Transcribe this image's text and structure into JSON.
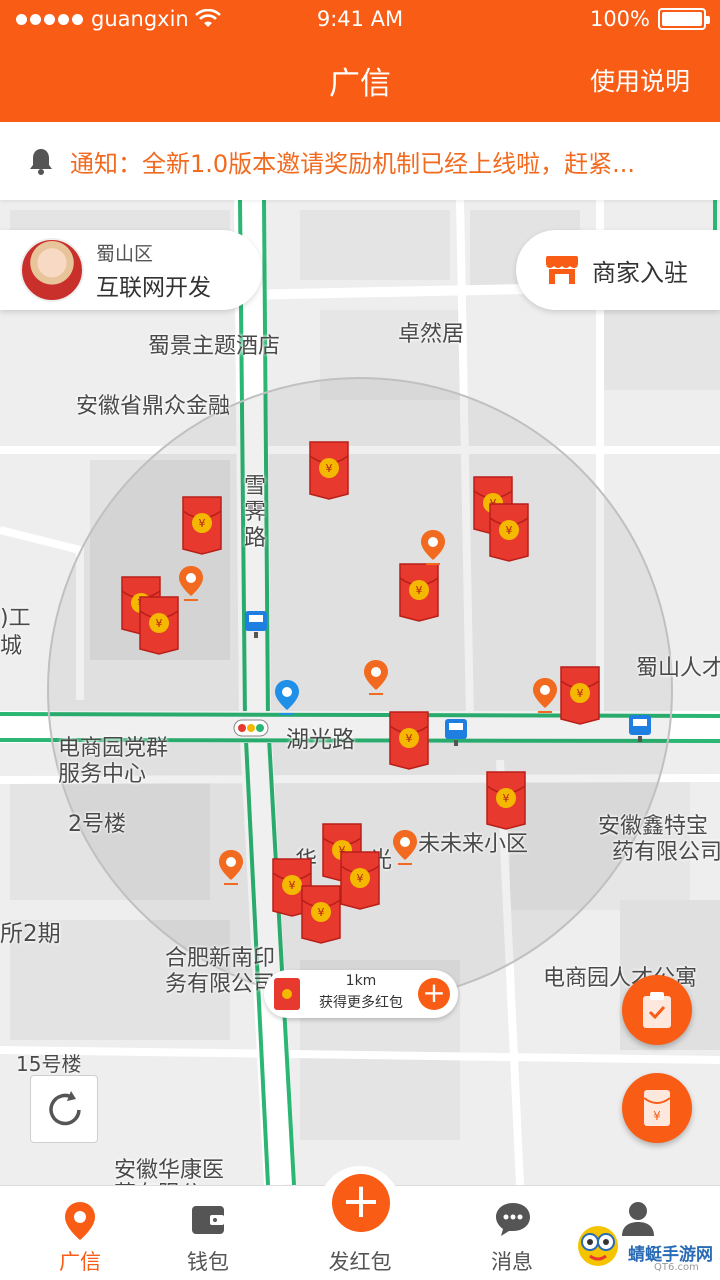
{
  "status_bar": {
    "carrier": "guangxin",
    "time": "9:41 AM",
    "battery": "100%"
  },
  "nav": {
    "title": "广信",
    "help": "使用说明"
  },
  "notice": {
    "text": "通知：全新1.0版本邀请奖励机制已经上线啦，赶紧..."
  },
  "location": {
    "district": "蜀山区",
    "name": "互联网开发"
  },
  "merchant": {
    "label": "商家入驻"
  },
  "map": {
    "pois": [
      "蜀景主题酒店",
      "卓然居",
      "安徽省鼎众金融",
      "雪",
      "霁",
      "路",
      ")工",
      "城",
      "蜀山人才",
      "湖光路",
      "电商园党群",
      "服务中心",
      "2号楼",
      "安徽鑫特宝",
      "药有限公司",
      "未未来小区",
      "华",
      "光",
      "所2期",
      "合肥新南印",
      "务有限公司",
      "电商园人才公寓",
      "15号楼",
      "安徽华康医",
      "药有限公"
    ],
    "radius_km": "1km",
    "radius_tip": "获得更多红包",
    "redpack_count": 15
  },
  "tabs": [
    {
      "label": "广信",
      "active": true
    },
    {
      "label": "钱包",
      "active": false
    },
    {
      "label": "发红包",
      "active": false
    },
    {
      "label": "消息",
      "active": false
    },
    {
      "label": "我的",
      "active": false
    }
  ],
  "watermark": {
    "text": "蜻蜓手游网",
    "sub": "QT6.com"
  },
  "colors": {
    "accent": "#f95c14",
    "redpack": "#e8392f",
    "road_green": "#2bb673"
  }
}
